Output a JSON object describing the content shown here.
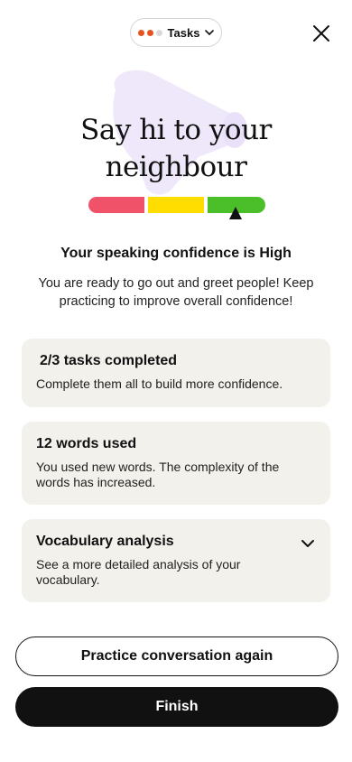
{
  "header": {
    "tasks_label": "Tasks",
    "dots": [
      "#e8521f",
      "#e8521f",
      "#d9d9d9"
    ]
  },
  "headline": {
    "line1": "Say hi to your",
    "line2": "neighbour"
  },
  "meter": {
    "colors": {
      "low": "#f0526a",
      "medium": "#ffdd00",
      "high": "#4bbf2a"
    },
    "level": "High"
  },
  "confidence": {
    "title": "Your speaking confidence is High",
    "description": "You are ready to go out and greet people! Keep practicing to improve overall confidence!"
  },
  "cards": [
    {
      "title": "2/3 tasks completed",
      "description": "Complete them all to build more confidence."
    },
    {
      "title": "12 words used",
      "description": "You used new words. The complexity of the words has increased."
    },
    {
      "title": "Vocabulary analysis",
      "description": "See a more detailed analysis of your vocabulary."
    }
  ],
  "buttons": {
    "practice_again": "Practice conversation again",
    "finish": "Finish"
  }
}
